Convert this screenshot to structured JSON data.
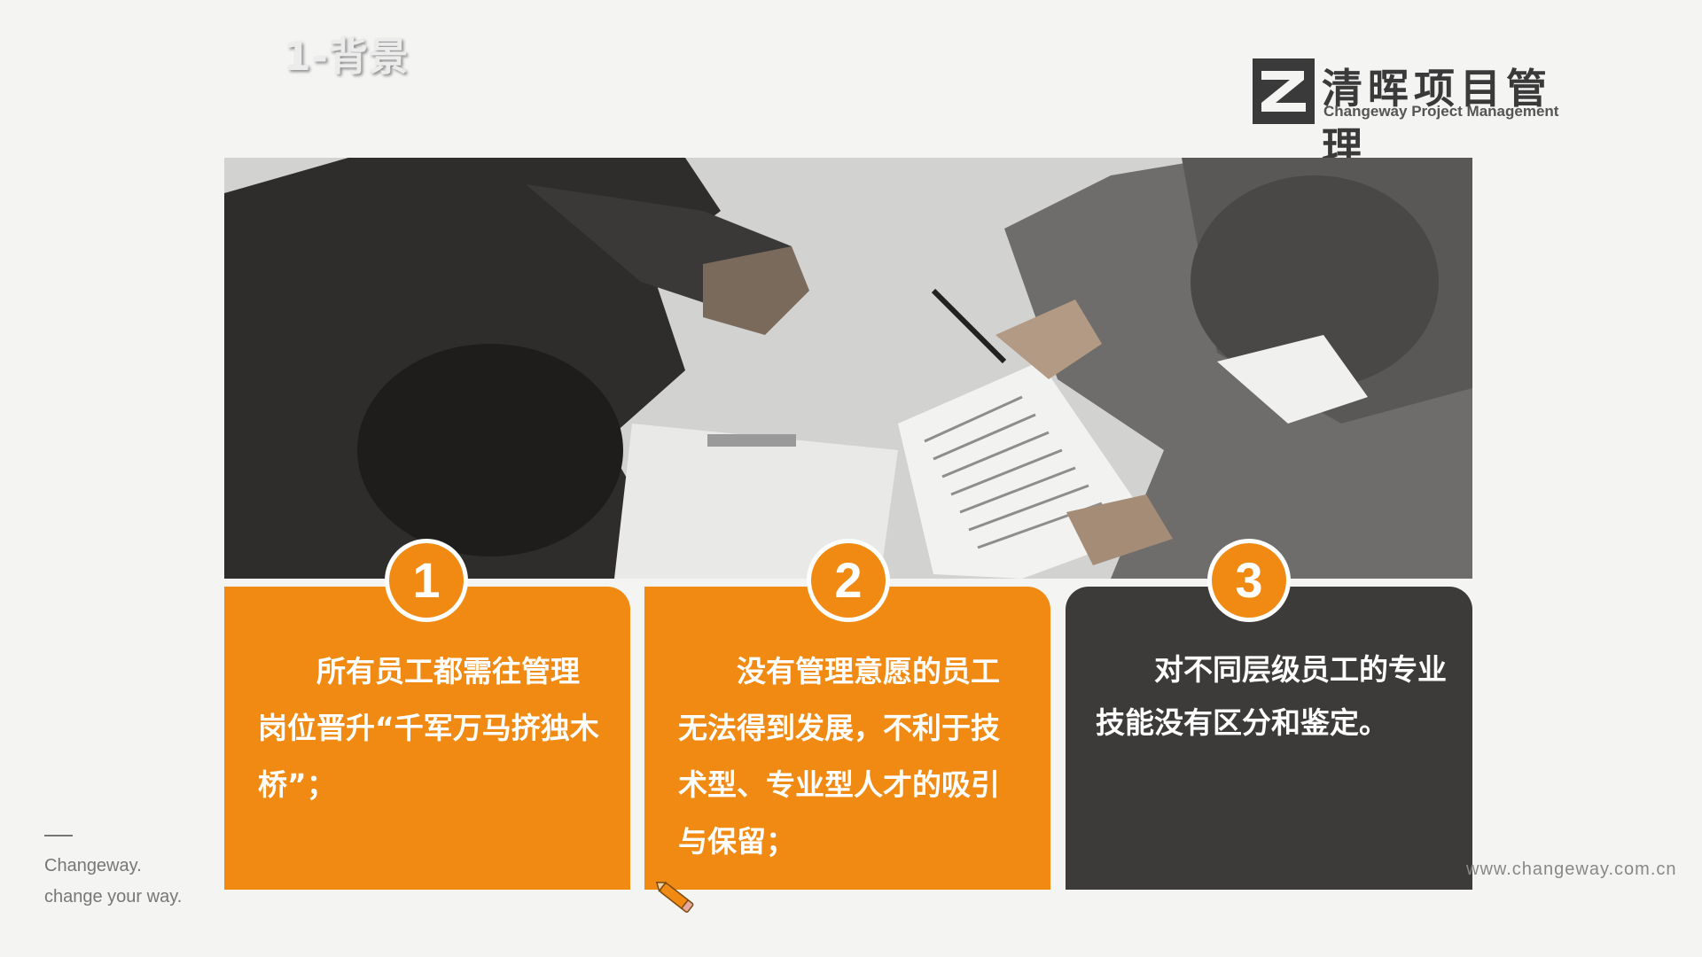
{
  "slide": {
    "title": "1-背景"
  },
  "logo": {
    "name_cn": "清晖项目管理",
    "name_en": "Changeway Project Management",
    "mark_icon": "changeway-logo-icon"
  },
  "cards": [
    {
      "number": "1",
      "text": "所有员工都需往管理岗位晋升“千军万马挤独木桥”；"
    },
    {
      "number": "2",
      "text": "没有管理意愿的员工无法得到发展，不利于技术型、专业型人才的吸引与保留；"
    },
    {
      "number": "3",
      "text": "对不同层级员工的专业技能没有区分和鉴定。"
    }
  ],
  "footer": {
    "line1": "Changeway.",
    "line2": "change your way.",
    "url": "www.changeway.com.cn"
  },
  "colors": {
    "accent_orange": "#f08a12",
    "dark_card": "#3d3b39",
    "background": "#f4f4f2"
  }
}
